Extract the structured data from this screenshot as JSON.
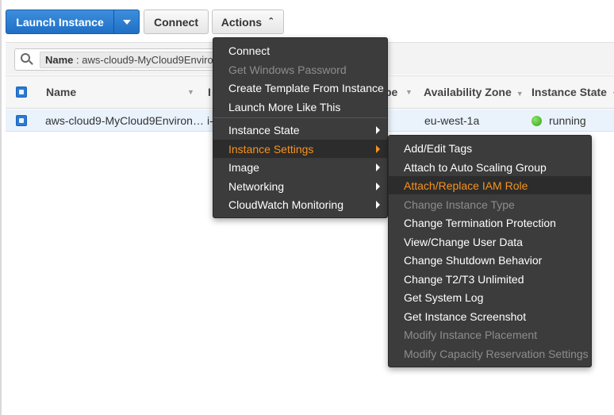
{
  "toolbar": {
    "launch_label": "Launch Instance",
    "connect_label": "Connect",
    "actions_label": "Actions"
  },
  "filter": {
    "token_key": "Name",
    "token_sep": " : ",
    "token_value": "aws-cloud9-MyCloud9Environ"
  },
  "table": {
    "columns": [
      "Name",
      "I",
      "pe",
      "Availability Zone",
      "Instance State"
    ],
    "row": {
      "name": "aws-cloud9-MyCloud9Environ…",
      "instance_id": "i-",
      "availability_zone": "eu-west-1a",
      "state": "running"
    }
  },
  "actions_menu": {
    "items": [
      {
        "label": "Connect",
        "enabled": true
      },
      {
        "label": "Get Windows Password",
        "enabled": false
      },
      {
        "label": "Create Template From Instance",
        "enabled": true
      },
      {
        "label": "Launch More Like This",
        "enabled": true
      },
      {
        "label": "Instance State",
        "enabled": true,
        "submenu": true
      },
      {
        "label": "Instance Settings",
        "enabled": true,
        "submenu": true,
        "active": true
      },
      {
        "label": "Image",
        "enabled": true,
        "submenu": true
      },
      {
        "label": "Networking",
        "enabled": true,
        "submenu": true
      },
      {
        "label": "CloudWatch Monitoring",
        "enabled": true,
        "submenu": true
      }
    ]
  },
  "settings_menu": {
    "items": [
      {
        "label": "Add/Edit Tags",
        "enabled": true
      },
      {
        "label": "Attach to Auto Scaling Group",
        "enabled": true
      },
      {
        "label": "Attach/Replace IAM Role",
        "enabled": true,
        "active": true
      },
      {
        "label": "Change Instance Type",
        "enabled": false
      },
      {
        "label": "Change Termination Protection",
        "enabled": true
      },
      {
        "label": "View/Change User Data",
        "enabled": true
      },
      {
        "label": "Change Shutdown Behavior",
        "enabled": true
      },
      {
        "label": "Change T2/T3 Unlimited",
        "enabled": true
      },
      {
        "label": "Get System Log",
        "enabled": true
      },
      {
        "label": "Get Instance Screenshot",
        "enabled": true
      },
      {
        "label": "Modify Instance Placement",
        "enabled": false
      },
      {
        "label": "Modify Capacity Reservation Settings",
        "enabled": false
      }
    ]
  },
  "colors": {
    "primary": "#1f6fc5",
    "menu_bg": "#3c3c3c",
    "highlight": "#f7931e",
    "running": "#2ea80f"
  }
}
